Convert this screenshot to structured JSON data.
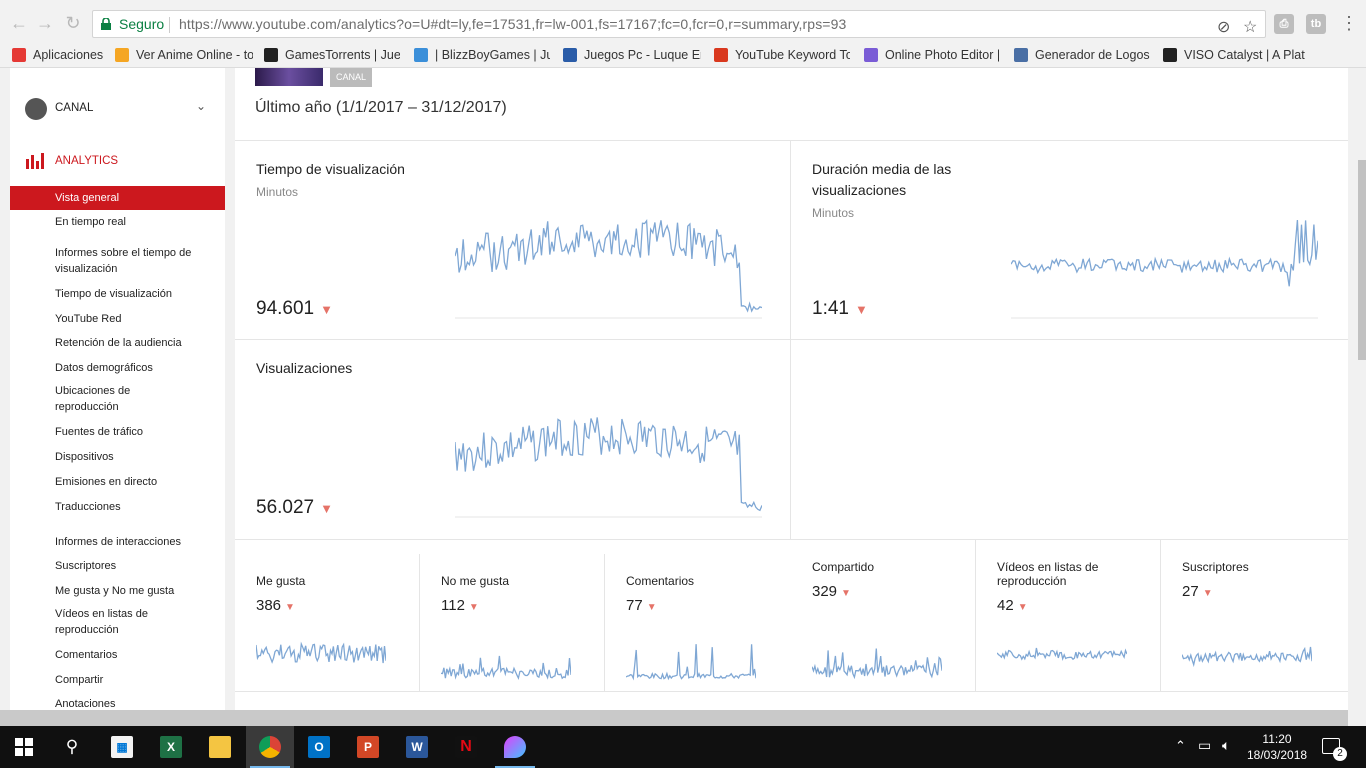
{
  "browser": {
    "secure_label": "Seguro",
    "url": "https://www.youtube.com/analytics?o=U#dt=ly,fe=17531,fr=lw-001,fs=17167;fc=0,fcr=0,r=summary,rps=93",
    "bookmarks": [
      {
        "label": "Aplicaciones",
        "icon": "apps-grid-icon",
        "color": "#e53935"
      },
      {
        "label": "Ver Anime Online - to",
        "icon": "anime-favicon",
        "color": "#f5a623"
      },
      {
        "label": "GamesTorrents | Jueg",
        "icon": "gamestorrents-favicon",
        "color": "#222222"
      },
      {
        "label": "| BlizzBoyGames | Jue",
        "icon": "blizzboy-favicon",
        "color": "#3b8fd9"
      },
      {
        "label": "Juegos Pc - Luque En",
        "icon": "luque-favicon",
        "color": "#2a5ca8"
      },
      {
        "label": "YouTube Keyword To",
        "icon": "keyword-tool-favicon",
        "color": "#d9381e"
      },
      {
        "label": "Online Photo Editor |",
        "icon": "photo-editor-favicon",
        "color": "#7a5cd6"
      },
      {
        "label": "Generador de Logos y",
        "icon": "logo-generator-favicon",
        "color": "#4a6fa5"
      },
      {
        "label": "VISO Catalyst | A Platf",
        "icon": "viso-favicon",
        "color": "#222222"
      }
    ]
  },
  "sidebar": {
    "canal": "CANAL",
    "analytics": "ANALYTICS",
    "items": [
      {
        "label": "Vista general",
        "active": true
      },
      {
        "label": "En tiempo real"
      },
      {
        "label": "Informes sobre el tiempo de visualización"
      },
      {
        "label": "Tiempo de visualización"
      },
      {
        "label": "YouTube Red"
      },
      {
        "label": "Retención de la audiencia"
      },
      {
        "label": "Datos demográficos"
      },
      {
        "label": "Ubicaciones de reproducción"
      },
      {
        "label": "Fuentes de tráfico"
      },
      {
        "label": "Dispositivos"
      },
      {
        "label": "Emisiones en directo"
      },
      {
        "label": "Traducciones"
      },
      {
        "label": "Informes de interacciones"
      },
      {
        "label": "Suscriptores"
      },
      {
        "label": "Me gusta y No me gusta"
      },
      {
        "label": "Vídeos en listas de reproducción"
      },
      {
        "label": "Comentarios"
      },
      {
        "label": "Compartir"
      },
      {
        "label": "Anotaciones"
      }
    ]
  },
  "main": {
    "channel_badge": "CANAL",
    "period": "Último año (1/1/2017 – 31/12/2017)",
    "cards": {
      "watch_time": {
        "title": "Tiempo de visualización",
        "subtitle": "Minutos",
        "value": "94.601"
      },
      "avg_duration": {
        "title": "Duración media de las visualizaciones",
        "subtitle": "Minutos",
        "value": "1:41"
      },
      "views": {
        "title": "Visualizaciones",
        "value": "56.027"
      }
    },
    "metrics": [
      {
        "title": "Me gusta",
        "value": "386"
      },
      {
        "title": "No me gusta",
        "value": "112"
      },
      {
        "title": "Comentarios",
        "value": "77"
      },
      {
        "title": "Compartido",
        "value": "329"
      },
      {
        "title": "Vídeos en listas de reproducción",
        "value": "42"
      },
      {
        "title": "Suscriptores",
        "value": "27"
      }
    ],
    "trend_color": "#e57368",
    "sparkline_color": "#7fa7d4"
  },
  "taskbar": {
    "time": "11:20",
    "date": "18/03/2018",
    "notifications": "2"
  }
}
